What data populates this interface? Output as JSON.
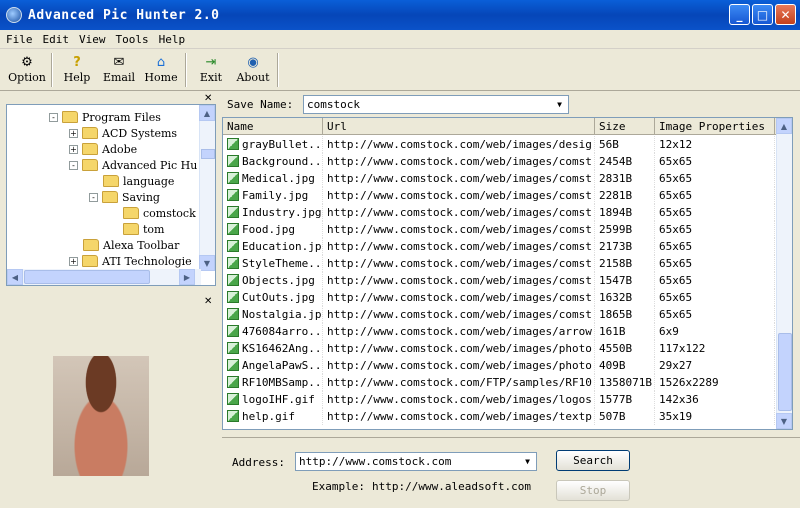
{
  "window": {
    "title": "Advanced Pic Hunter 2.0"
  },
  "menu": [
    "File",
    "Edit",
    "View",
    "Tools",
    "Help"
  ],
  "toolbar": [
    {
      "label": "Option",
      "icon": "options-icon"
    },
    {
      "label": "Help",
      "icon": "help-icon"
    },
    {
      "label": "Email",
      "icon": "email-icon"
    },
    {
      "label": "Home",
      "icon": "home-icon"
    },
    {
      "label": "Exit",
      "icon": "exit-icon"
    },
    {
      "label": "About",
      "icon": "about-icon"
    }
  ],
  "tree": [
    {
      "label": "Program Files",
      "expander": "-",
      "level": 0
    },
    {
      "label": "ACD Systems",
      "expander": "+",
      "level": 1
    },
    {
      "label": "Adobe",
      "expander": "+",
      "level": 1
    },
    {
      "label": "Advanced Pic Hu",
      "expander": "-",
      "level": 1
    },
    {
      "label": "language",
      "expander": "",
      "level": 2
    },
    {
      "label": "Saving",
      "expander": "-",
      "level": 2
    },
    {
      "label": "comstock",
      "expander": "",
      "level": 3
    },
    {
      "label": "tom",
      "expander": "",
      "level": 3
    },
    {
      "label": "Alexa Toolbar",
      "expander": "",
      "level": 1
    },
    {
      "label": "ATI Technologie",
      "expander": "+",
      "level": 1
    }
  ],
  "save": {
    "label": "Save Name:",
    "value": "comstock"
  },
  "list": {
    "columns": [
      "Name",
      "Url",
      "Size",
      "Image Properties"
    ],
    "rows": [
      [
        "grayBullet...",
        "http://www.comstock.com/web/images/desig...",
        "56B",
        "12x12"
      ],
      [
        "Background...",
        "http://www.comstock.com/web/images/comst...",
        "2454B",
        "65x65"
      ],
      [
        "Medical.jpg",
        "http://www.comstock.com/web/images/comst...",
        "2831B",
        "65x65"
      ],
      [
        "Family.jpg",
        "http://www.comstock.com/web/images/comst...",
        "2281B",
        "65x65"
      ],
      [
        "Industry.jpg",
        "http://www.comstock.com/web/images/comst...",
        "1894B",
        "65x65"
      ],
      [
        "Food.jpg",
        "http://www.comstock.com/web/images/comst...",
        "2599B",
        "65x65"
      ],
      [
        "Education.jpg",
        "http://www.comstock.com/web/images/comst...",
        "2173B",
        "65x65"
      ],
      [
        "StyleTheme...",
        "http://www.comstock.com/web/images/comst...",
        "2158B",
        "65x65"
      ],
      [
        "Objects.jpg",
        "http://www.comstock.com/web/images/comst...",
        "1547B",
        "65x65"
      ],
      [
        "CutOuts.jpg",
        "http://www.comstock.com/web/images/comst...",
        "1632B",
        "65x65"
      ],
      [
        "Nostalgia.jpg",
        "http://www.comstock.com/web/images/comst...",
        "1865B",
        "65x65"
      ],
      [
        "476084arro...",
        "http://www.comstock.com/web/images/arrow...",
        "161B",
        "6x9"
      ],
      [
        "KS16462Ang...",
        "http://www.comstock.com/web/images/photo...",
        "4550B",
        "117x122"
      ],
      [
        "AngelaPawS...",
        "http://www.comstock.com/web/images/photo...",
        "409B",
        "29x27"
      ],
      [
        "RF10MBSamp...",
        "http://www.comstock.com/FTP/samples/RF10...",
        "1358071B",
        "1526x2289"
      ],
      [
        "logoIHF.gif",
        "http://www.comstock.com/web/images/logos...",
        "1577B",
        "142x36"
      ],
      [
        "help.gif",
        "http://www.comstock.com/web/images/textp...",
        "507B",
        "35x19"
      ]
    ]
  },
  "address": {
    "label": "Address:",
    "value": "http://www.comstock.com",
    "example_label": "Example:",
    "example_value": "http://www.aleadsoft.com"
  },
  "buttons": {
    "search": "Search",
    "stop": "Stop"
  }
}
